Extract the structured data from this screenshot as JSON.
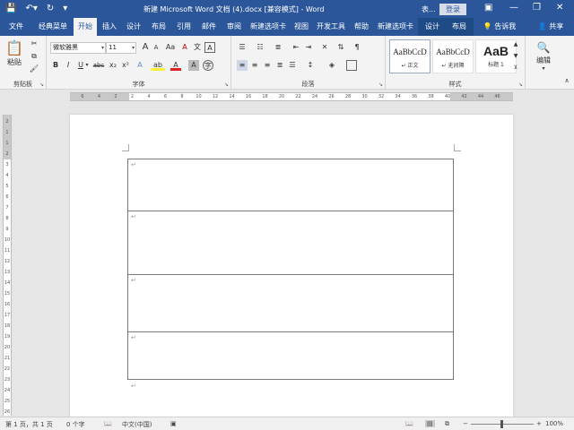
{
  "titlebar": {
    "title": "新建 Microsoft Word 文档 (4).docx [兼容模式] - Word",
    "login": "登录",
    "user_short": "表...",
    "minimize": "—",
    "restore": "❐",
    "close": "✕"
  },
  "tabs": [
    {
      "label": "文件"
    },
    {
      "label": "经典菜单"
    },
    {
      "label": "开始"
    },
    {
      "label": "插入"
    },
    {
      "label": "设计"
    },
    {
      "label": "布局"
    },
    {
      "label": "引用"
    },
    {
      "label": "邮件"
    },
    {
      "label": "审阅"
    },
    {
      "label": "新建选项卡"
    },
    {
      "label": "视图"
    },
    {
      "label": "开发工具"
    },
    {
      "label": "帮助"
    },
    {
      "label": "新建选项卡"
    },
    {
      "label": "设计"
    },
    {
      "label": "布局"
    }
  ],
  "tell_me": "告诉我",
  "share": "共享",
  "ribbon": {
    "clipboard": {
      "paste": "粘贴",
      "label": "剪贴板"
    },
    "font": {
      "name": "微软雅黑",
      "size": "11",
      "label": "字体",
      "bold": "B",
      "italic": "I",
      "underline": "U",
      "strike": "abc",
      "subscript": "x₂",
      "superscript": "x²",
      "grow": "A",
      "shrink": "A",
      "case": "Aa",
      "clear": "A",
      "pinyin": "文",
      "border": "A",
      "effects": "A",
      "highlight": "ab",
      "color": "A",
      "shade": "A",
      "circle": "字"
    },
    "paragraph": {
      "label": "段落"
    },
    "styles": {
      "label": "样式",
      "items": [
        {
          "preview": "AaBbCcD",
          "name": "↵ 正文"
        },
        {
          "preview": "AaBbCcD",
          "name": "↵ 无间隔"
        },
        {
          "preview": "AaB",
          "name": "标题 1"
        }
      ]
    },
    "editing": {
      "label": "编辑"
    }
  },
  "ruler": {
    "numbers": [
      "6",
      "4",
      "2",
      "2",
      "4",
      "6",
      "8",
      "10",
      "12",
      "14",
      "16",
      "18",
      "20",
      "22",
      "24",
      "26",
      "28",
      "30",
      "32",
      "34",
      "36",
      "38",
      "40",
      "42",
      "44",
      "46"
    ]
  },
  "vruler": {
    "numbers": [
      "2",
      "1",
      "1",
      "2",
      "3",
      "4",
      "5",
      "6",
      "7",
      "8",
      "9",
      "10",
      "11",
      "12",
      "13",
      "14",
      "15",
      "16",
      "17",
      "18",
      "19",
      "20",
      "21",
      "22",
      "23",
      "24",
      "25",
      "26"
    ]
  },
  "document": {
    "para_mark": "↵"
  },
  "statusbar": {
    "page": "第 1 页，共 1 页",
    "words": "0 个字",
    "lang": "中文(中国)",
    "zoom": "100%",
    "zoom_minus": "−",
    "zoom_plus": "+"
  },
  "colors": {
    "accent": "#2b579a",
    "ribbon_bg": "#f3f3f3",
    "canvas_bg": "#e6e6e6"
  }
}
